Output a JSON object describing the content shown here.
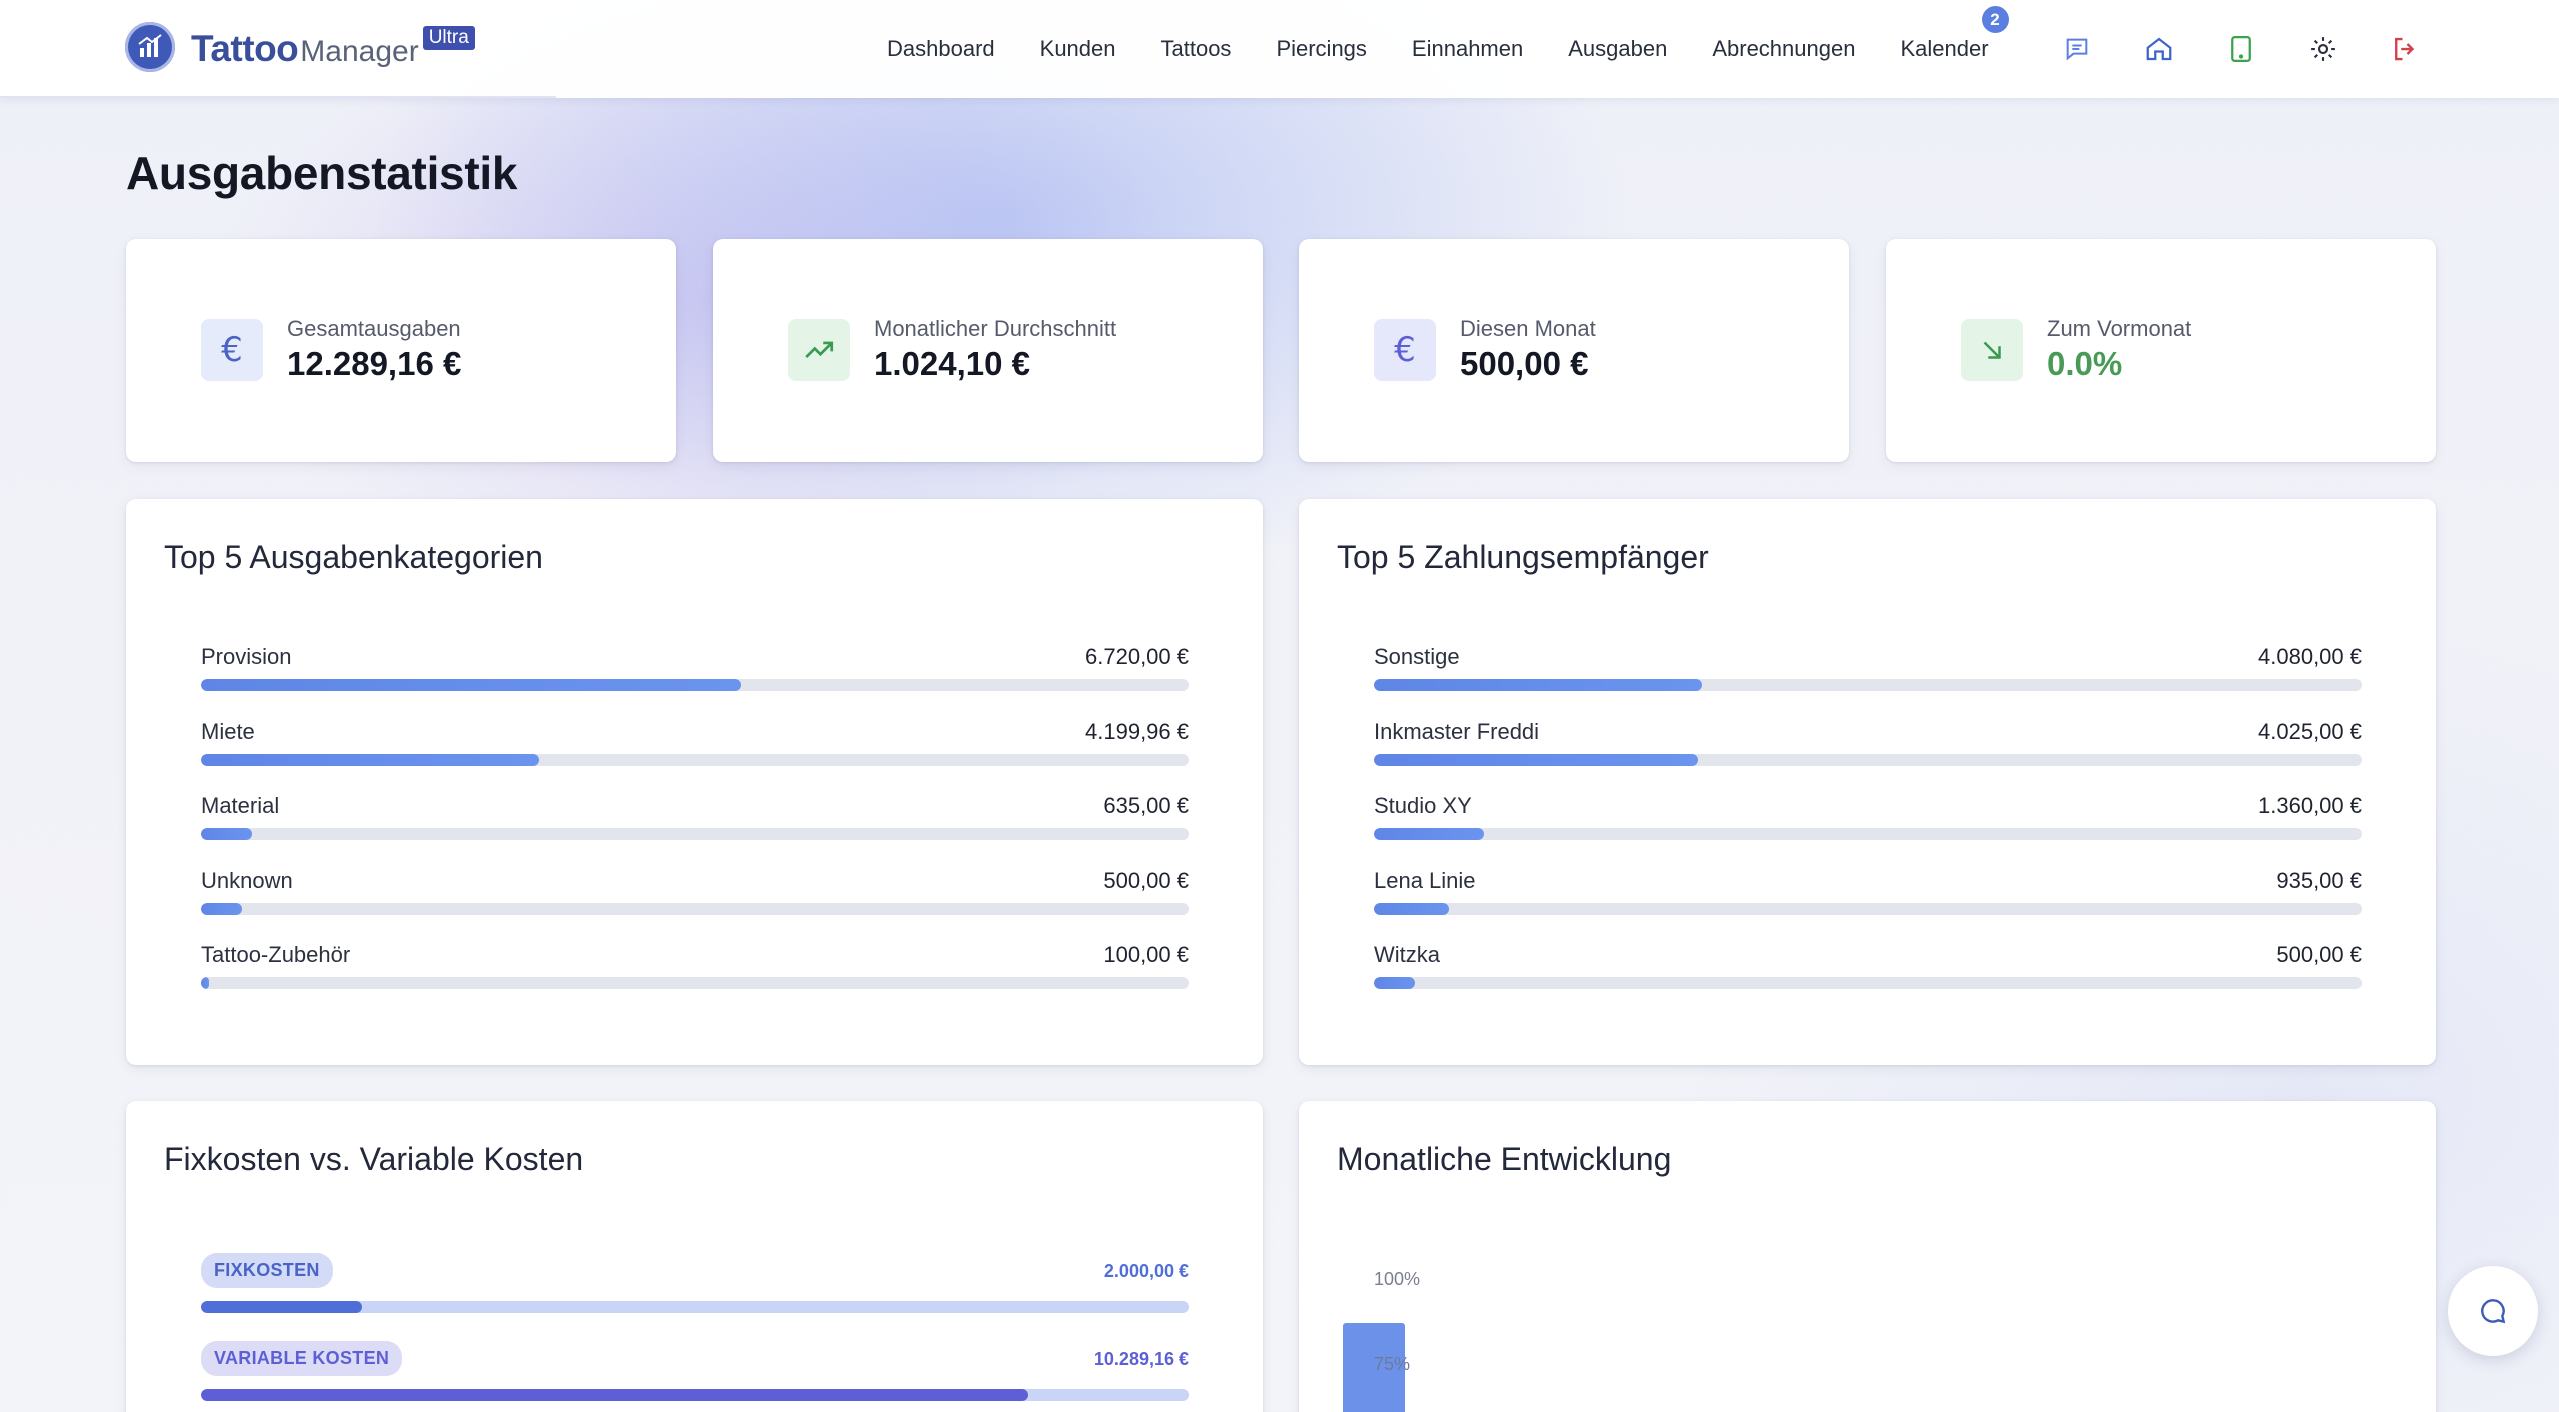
{
  "app": {
    "logo_main": "Tattoo",
    "logo_sub": "Manager",
    "logo_tag": "Ultra"
  },
  "nav": {
    "items": [
      {
        "label": "Dashboard"
      },
      {
        "label": "Kunden"
      },
      {
        "label": "Tattoos"
      },
      {
        "label": "Piercings"
      },
      {
        "label": "Einnahmen"
      },
      {
        "label": "Ausgaben"
      },
      {
        "label": "Abrechnungen"
      },
      {
        "label": "Kalender",
        "badge": "2"
      }
    ],
    "icons": [
      "messages-icon",
      "home-icon",
      "tablet-icon",
      "settings-gear-icon",
      "logout-icon"
    ]
  },
  "page": {
    "title": "Ausgabenstatistik"
  },
  "stats": [
    {
      "label": "Gesamtausgaben",
      "value": "12.289,16 €",
      "icon": "euro-icon",
      "color": "#141824"
    },
    {
      "label": "Monatlicher Durchschnitt",
      "value": "1.024,10 €",
      "icon": "trending-up-icon",
      "color": "#141824"
    },
    {
      "label": "Diesen Monat",
      "value": "500,00 €",
      "icon": "euro-icon",
      "color": "#141824"
    },
    {
      "label": "Zum Vormonat",
      "value": "0.0%",
      "icon": "arrow-down-right-icon",
      "color": "#4a9a57"
    }
  ],
  "categories": {
    "title": "Top 5 Ausgabenkategorien",
    "items": [
      {
        "label": "Provision",
        "value": "6.720,00 €",
        "share": 0.547
      },
      {
        "label": "Miete",
        "value": "4.199,96 €",
        "share": 0.342
      },
      {
        "label": "Material",
        "value": "635,00 €",
        "share": 0.052
      },
      {
        "label": "Unknown",
        "value": "500,00 €",
        "share": 0.041
      },
      {
        "label": "Tattoo-Zubehör",
        "value": "100,00 €",
        "share": 0.008
      }
    ]
  },
  "recipients": {
    "title": "Top 5 Zahlungsempfänger",
    "items": [
      {
        "label": "Sonstige",
        "value": "4.080,00 €",
        "share": 0.332
      },
      {
        "label": "Inkmaster Freddi",
        "value": "4.025,00 €",
        "share": 0.328
      },
      {
        "label": "Studio XY",
        "value": "1.360,00 €",
        "share": 0.111
      },
      {
        "label": "Lena Linie",
        "value": "935,00 €",
        "share": 0.076
      },
      {
        "label": "Witzka",
        "value": "500,00 €",
        "share": 0.041
      }
    ]
  },
  "costs": {
    "title": "Fixkosten vs. Variable Kosten",
    "fixed": {
      "label": "FIXKOSTEN",
      "value": "2.000,00 €",
      "share": 0.163
    },
    "variable": {
      "label": "VARIABLE KOSTEN",
      "value": "10.289,16 €",
      "share": 0.837
    }
  },
  "monthly": {
    "title": "Monatliche Entwicklung",
    "ticks": [
      "100%",
      "75%"
    ]
  },
  "colors": {
    "accent": "#5b7fe0",
    "variable": "#5d5fd6",
    "fixed": "#4f6ed8",
    "positive": "#4a9a57",
    "logout": "#d2404a"
  }
}
